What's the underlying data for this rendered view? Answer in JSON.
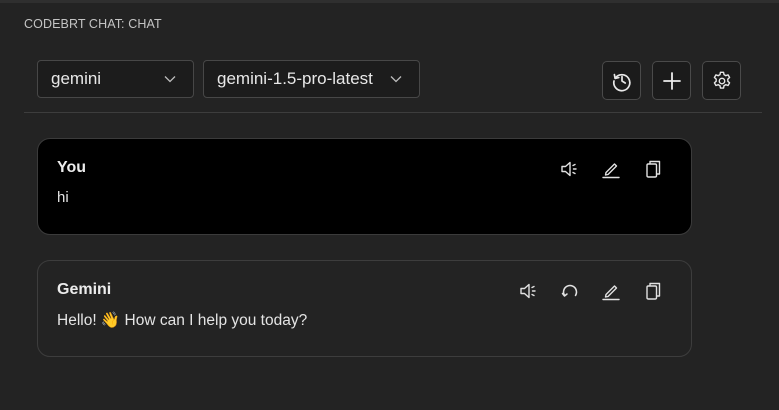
{
  "panel": {
    "title": "CODEBRT CHAT: CHAT"
  },
  "toolbar": {
    "provider": {
      "value": "gemini"
    },
    "model": {
      "value": "gemini-1.5-pro-latest"
    }
  },
  "messages": [
    {
      "sender": "You",
      "text": "hi",
      "actions": [
        "speaker-icon",
        "edit-icon",
        "copy-icon"
      ]
    },
    {
      "sender": "Gemini",
      "text": "Hello! 👋 How can I help you today?",
      "actions": [
        "speaker-icon",
        "regenerate-icon",
        "edit-icon",
        "copy-icon"
      ]
    }
  ]
}
